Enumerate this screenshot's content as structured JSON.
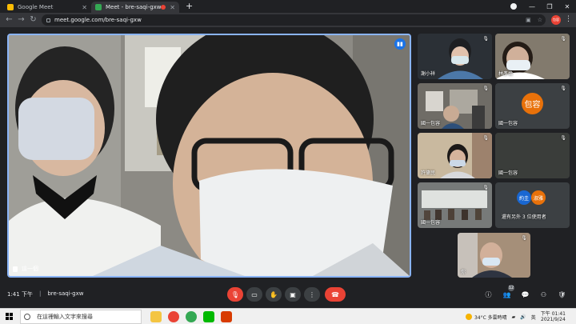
{
  "browser": {
    "tabs": [
      {
        "title": "Google Meet",
        "favicon": "meet-favicon-yellow"
      },
      {
        "title": "Meet - bre-saqi-gxw",
        "favicon": "meet-favicon-green",
        "recording": true
      }
    ],
    "new_tab_icon": "+",
    "address": "meet.google.com/bre-saqi-gxw",
    "nav_icons": {
      "back": "←",
      "forward": "→",
      "reload": "↻"
    },
    "omni_icons": {
      "camera": "▣",
      "star": "☆"
    },
    "profile_initials": "包容",
    "menu_icon": "⋮",
    "window_controls": [
      "—",
      "❐",
      "✕"
    ]
  },
  "meet": {
    "main_speaker_name": "這一個",
    "tiles": [
      {
        "name": "謝小祥",
        "muted": true
      },
      {
        "name": "林彥倫",
        "muted": true
      },
      {
        "name": "國一包容",
        "muted": true
      },
      {
        "name": "國一包容",
        "avatar": "包容",
        "muted": true
      },
      {
        "name": "許肇民",
        "muted": true
      },
      {
        "name": "國一包容",
        "muted": true
      },
      {
        "name": "國一包容",
        "muted": true
      },
      {
        "name": "還有另外 3 位使用者",
        "avatars": [
          "約圭",
          "淑雅"
        ]
      },
      {
        "name": "你",
        "muted": true
      }
    ],
    "bottom": {
      "time": "1:41 下午",
      "separator": "|",
      "meeting_code": "bre-saqi-gxw",
      "controls": [
        "mic-off",
        "camera-off",
        "raise-hand",
        "present",
        "more-options",
        "hang-up"
      ],
      "participants_count": "12"
    }
  },
  "taskbar": {
    "search_placeholder": "在這裡輸入文字來搜尋",
    "weather": "34°C 多雲時晴",
    "ime": "英",
    "time": "下午 01:41",
    "date": "2021/9/24",
    "apps": [
      "file-explorer",
      "chrome",
      "chrome-2",
      "line",
      "office"
    ]
  }
}
